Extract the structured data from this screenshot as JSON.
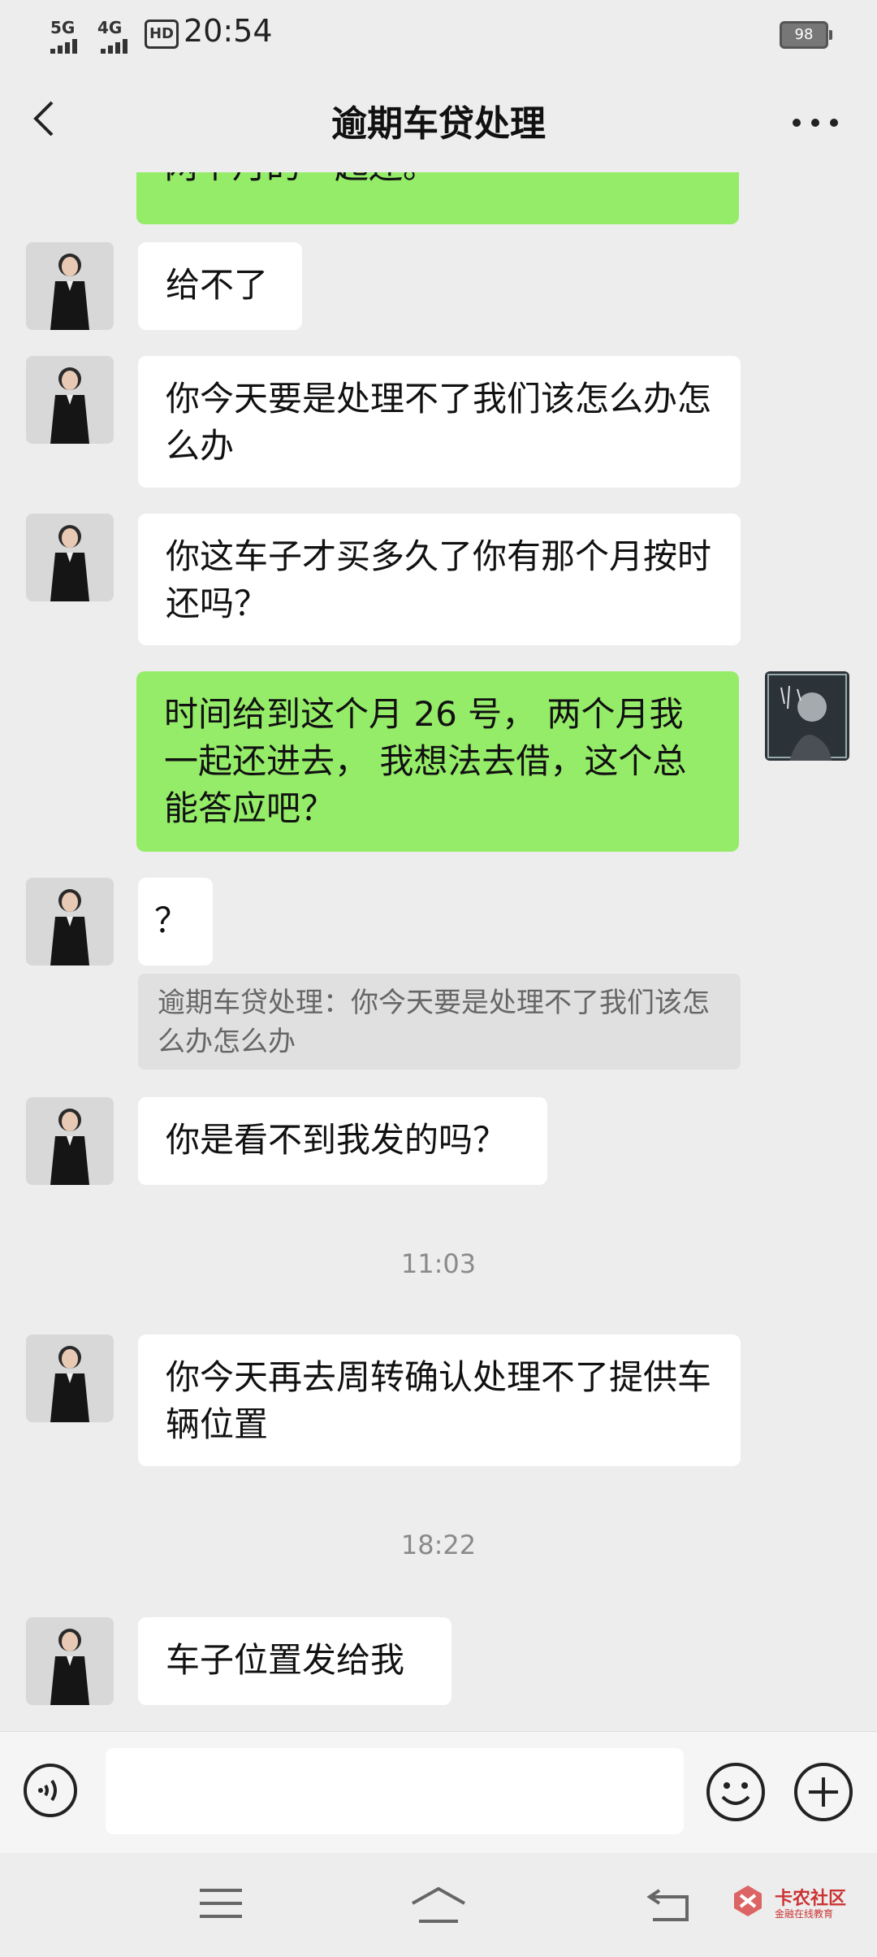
{
  "status_bar": {
    "network_1": "5G",
    "network_2": "4G",
    "hd_label": "HD",
    "time": "20:54",
    "battery": "98"
  },
  "header": {
    "title": "逾期车贷处理"
  },
  "messages": [
    {
      "sender": "self",
      "text": "两个月的一起还。"
    },
    {
      "sender": "other",
      "text": "给不了"
    },
    {
      "sender": "other",
      "text": "你今天要是处理不了我们该怎么办怎么办"
    },
    {
      "sender": "other",
      "text": "你这车子才买多久了你有那个月按时还吗？"
    },
    {
      "sender": "self",
      "text": "时间给到这个月 26 号， 两个月我一起还进去， 我想法去借，这个总能答应吧？"
    },
    {
      "sender": "other",
      "text": "？",
      "quote": "逾期车贷处理：你今天要是处理不了我们该怎么办怎么办"
    },
    {
      "sender": "other",
      "text": "你是看不到我发的吗？"
    },
    {
      "timestamp": "11:03"
    },
    {
      "sender": "other",
      "text": "你今天再去周转确认处理不了提供车辆位置"
    },
    {
      "timestamp": "18:22"
    },
    {
      "sender": "other",
      "text": "车子位置发给我"
    }
  ],
  "input_bar": {
    "voice_icon": "voice-icon",
    "emoji_icon": "emoji-icon",
    "plus_icon": "plus-icon"
  },
  "nav_bar": {
    "icons": [
      "menu-icon",
      "home-icon",
      "back-icon"
    ]
  },
  "watermark": {
    "name": "卡农社区",
    "tagline": "金融在线教育"
  },
  "colors": {
    "background": "#ededed",
    "sent_bubble": "#95ec69",
    "received_bubble": "#ffffff"
  }
}
